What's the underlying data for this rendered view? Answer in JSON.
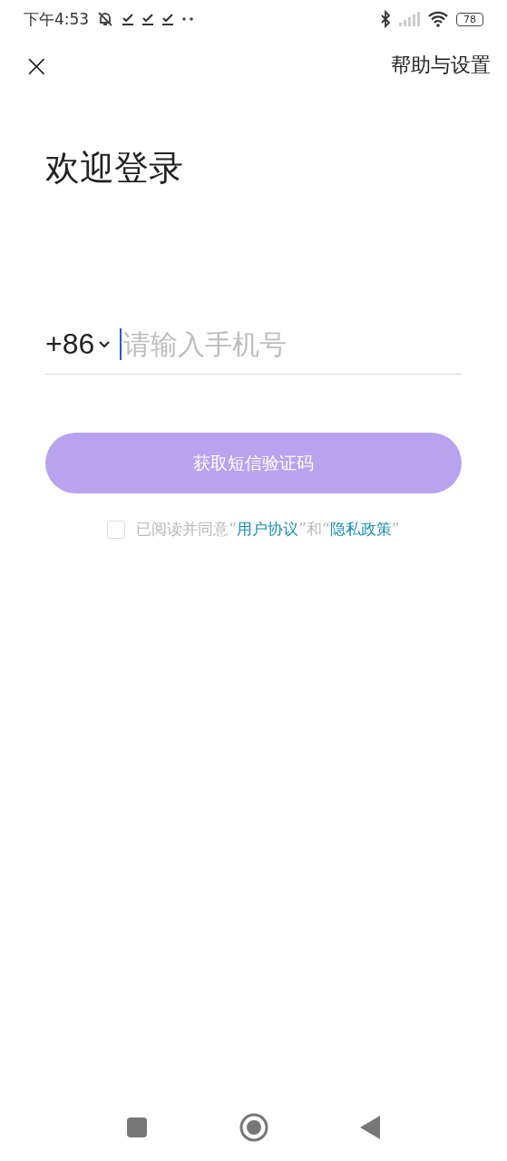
{
  "status_bar": {
    "time": "下午4:53",
    "notifications": [
      {
        "kind": "download_done"
      },
      {
        "kind": "download_done"
      },
      {
        "kind": "download_done"
      }
    ],
    "battery": "78"
  },
  "top_bar": {
    "close": "×",
    "help": "帮助与设置"
  },
  "title": "欢迎登录",
  "phone": {
    "country_code": "+86",
    "placeholder": "请输入手机号",
    "focused": true
  },
  "submit": {
    "label": "获取短信验证码",
    "disabled": true
  },
  "agreement": {
    "checked": false,
    "parts": [
      {
        "kind": "text",
        "text": "已阅读并同意“"
      },
      {
        "kind": "link",
        "text": "用户协议"
      },
      {
        "kind": "text",
        "text": "”和“"
      },
      {
        "kind": "link",
        "text": "隐私政策"
      },
      {
        "kind": "text",
        "text": "”"
      }
    ]
  }
}
